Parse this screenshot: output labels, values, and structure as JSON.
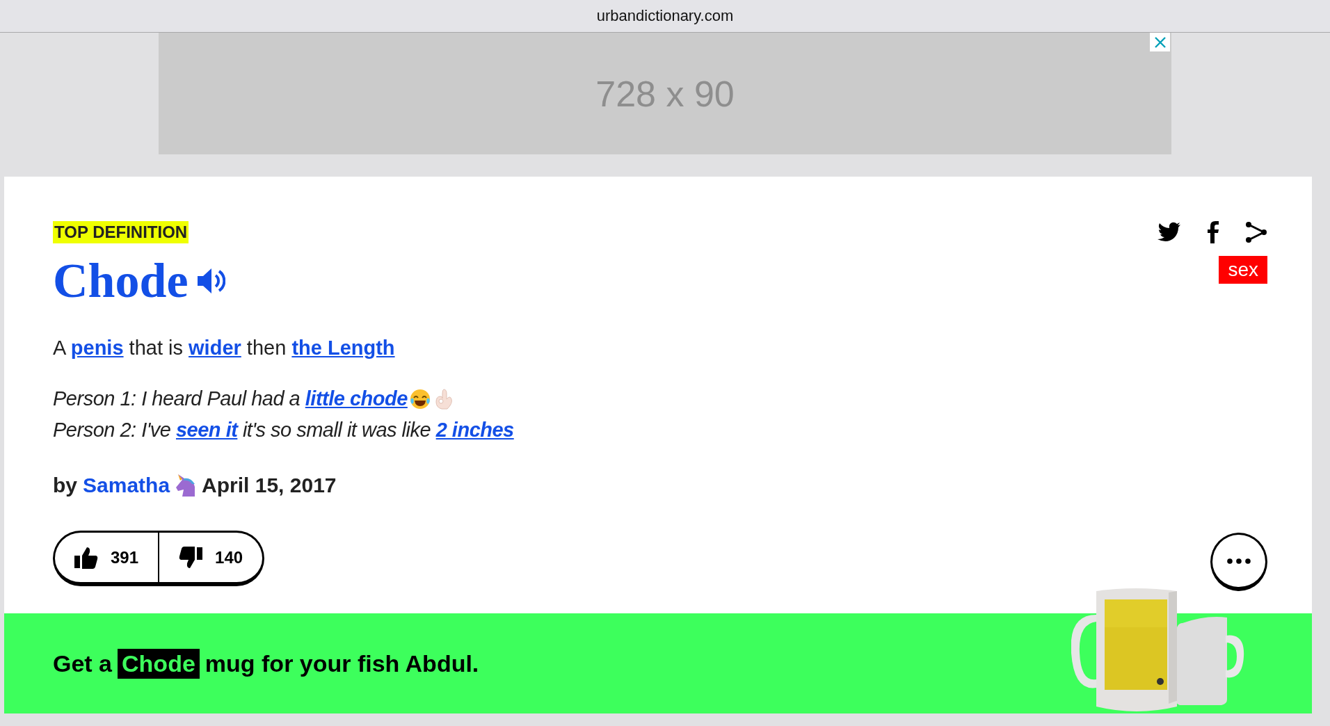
{
  "address_bar": {
    "url": "urbandictionary.com"
  },
  "ad": {
    "label": "728 x 90"
  },
  "definition": {
    "badge": "TOP DEFINITION",
    "word": "Chode",
    "meaning": [
      {
        "text": "A ",
        "link": false
      },
      {
        "text": "penis",
        "link": true
      },
      {
        "text": " that is ",
        "link": false
      },
      {
        "text": "wider",
        "link": true
      },
      {
        "text": " then ",
        "link": false
      },
      {
        "text": "the Length",
        "link": true
      }
    ],
    "example": [
      [
        {
          "text": "Person 1: I heard Paul had a ",
          "link": false
        },
        {
          "text": "little chode",
          "link": true
        }
      ],
      [
        {
          "text": "Person 2: I've ",
          "link": false
        },
        {
          "text": "seen it",
          "link": true
        },
        {
          "text": " it's so small it was like ",
          "link": false
        },
        {
          "text": "2 inches",
          "link": true
        }
      ]
    ],
    "author": {
      "prefix": "by",
      "name": "Samatha",
      "date": "April 15, 2017"
    },
    "tags": [
      {
        "label": "sex"
      }
    ],
    "votes": {
      "up": "391",
      "down": "140"
    }
  },
  "promo": [
    {
      "text": "Get a",
      "highlight": false
    },
    {
      "text": "Chode",
      "highlight": true
    },
    {
      "text": "mug for your fish Abdul.",
      "highlight": false
    }
  ]
}
